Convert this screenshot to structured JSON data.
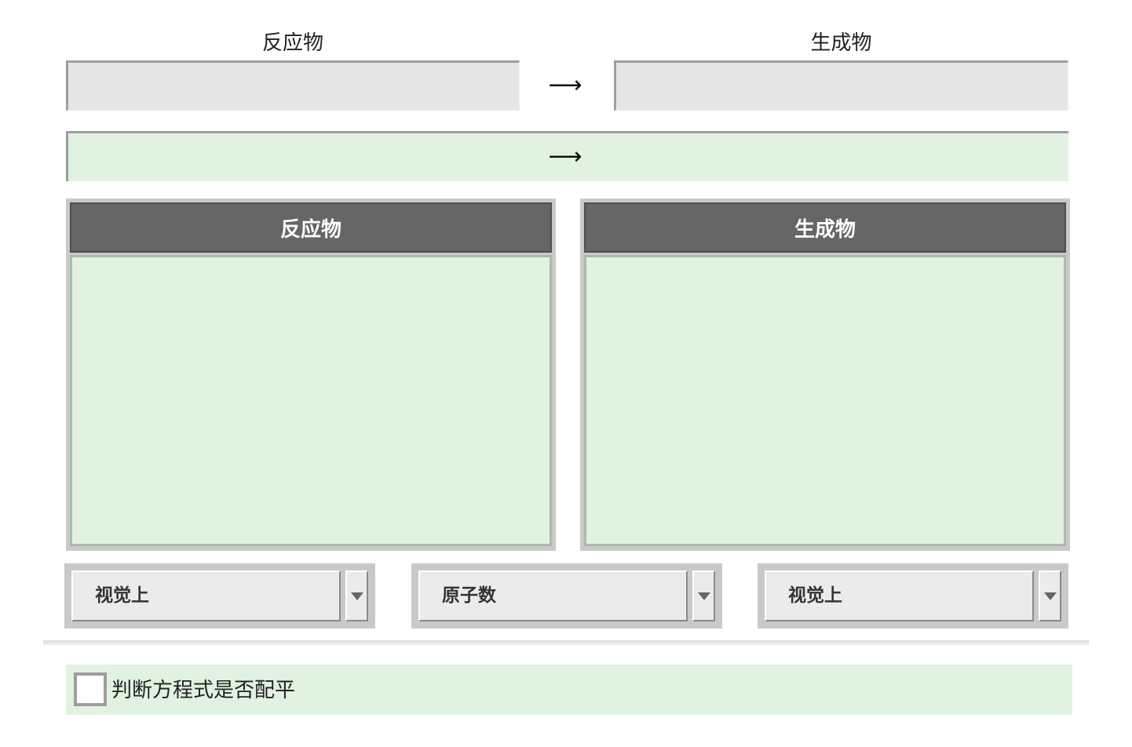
{
  "top": {
    "reactants_label": "反应物",
    "products_label": "生成物",
    "arrow": "⟶"
  },
  "equation_bar": {
    "arrow": "⟶"
  },
  "panels": {
    "reactants_title": "反应物",
    "products_title": "生成物"
  },
  "selects": [
    {
      "value": "视觉上"
    },
    {
      "value": "原子数"
    },
    {
      "value": "视觉上"
    }
  ],
  "balance_check": {
    "label": "判断方程式是否配平",
    "checked": false
  },
  "colors": {
    "panel_green": "#e1f2e1",
    "header_gray": "#666666",
    "input_gray": "#e6e6e6"
  }
}
